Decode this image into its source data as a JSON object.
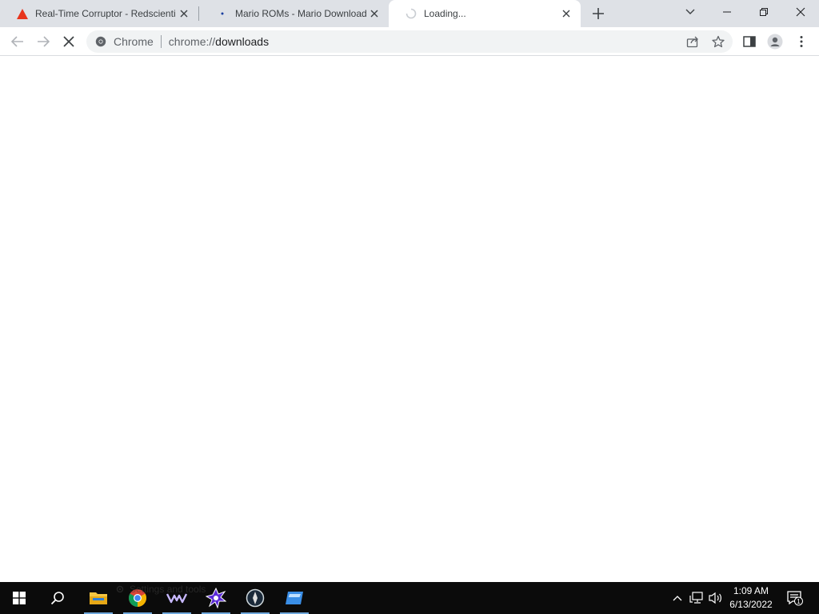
{
  "tabs": [
    {
      "title": "Real-Time Corruptor - Redscientist",
      "favicon": "red-triangle-icon",
      "close_label": "×"
    },
    {
      "title": "Mario ROMs - Mario Download - Nintendo",
      "favicon": "dot-icon",
      "close_label": "×"
    },
    {
      "title": "Loading...",
      "favicon": "loading-spinner-icon",
      "close_label": "×",
      "active": true
    }
  ],
  "window_controls": [
    "tab-search-icon",
    "minimize-icon",
    "restore-icon",
    "close-icon"
  ],
  "toolbar": {
    "back": "back-arrow-icon",
    "forward": "forward-arrow-icon",
    "stop": "stop-loading-icon"
  },
  "omnibox": {
    "chip": "Chrome",
    "url_scheme": "chrome://",
    "url_path": "downloads"
  },
  "ghost_text": "Settings and tools",
  "taskbar": {
    "apps": [
      "start-icon",
      "search-icon",
      "file-explorer-icon",
      "chrome-icon",
      "app-wave-icon",
      "app-star-icon",
      "app-circle-icon",
      "app-window-icon"
    ]
  },
  "clock": {
    "time": "1:09 AM",
    "date": "6/13/2022"
  },
  "notifications": {
    "count": "1"
  },
  "colors": {
    "tabstrip": "#dee1e6",
    "taskbar": "#0b0b0b",
    "accent": "#1a73e8"
  }
}
